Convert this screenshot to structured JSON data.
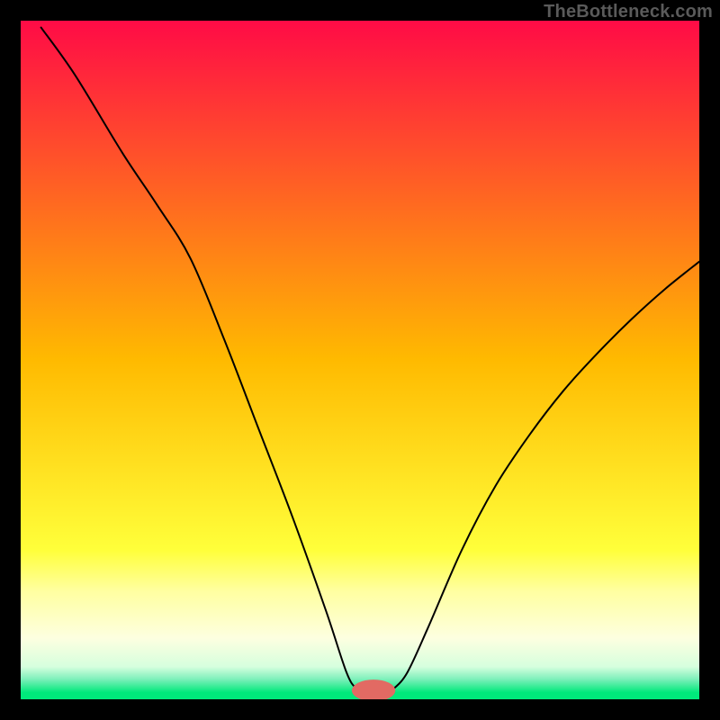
{
  "watermark": "TheBottleneck.com",
  "chart_data": {
    "type": "line",
    "title": "",
    "xlabel": "",
    "ylabel": "",
    "xlim": [
      0,
      100
    ],
    "ylim": [
      0,
      100
    ],
    "background": {
      "type": "vertical-gradient",
      "stops": [
        {
          "offset": 0.0,
          "color": "#ff0b46"
        },
        {
          "offset": 0.5,
          "color": "#ffba00"
        },
        {
          "offset": 0.78,
          "color": "#ffff3a"
        },
        {
          "offset": 0.84,
          "color": "#ffffa0"
        },
        {
          "offset": 0.91,
          "color": "#fdffe0"
        },
        {
          "offset": 0.952,
          "color": "#d6ffde"
        },
        {
          "offset": 0.97,
          "color": "#7ff0bb"
        },
        {
          "offset": 0.99,
          "color": "#00e97b"
        },
        {
          "offset": 1.0,
          "color": "#00e97b"
        }
      ]
    },
    "marker": {
      "x": 52.0,
      "y": 1.3,
      "color": "#e26a63",
      "rx": 3.2,
      "ry": 1.6
    },
    "series": [
      {
        "name": "bottleneck-curve",
        "color": "#000000",
        "width": 2,
        "points": [
          {
            "x": 3.0,
            "y": 99.0
          },
          {
            "x": 8.0,
            "y": 92.0
          },
          {
            "x": 15.0,
            "y": 80.5
          },
          {
            "x": 20.0,
            "y": 73.0
          },
          {
            "x": 25.0,
            "y": 65.0
          },
          {
            "x": 30.0,
            "y": 53.0
          },
          {
            "x": 35.0,
            "y": 40.0
          },
          {
            "x": 40.0,
            "y": 27.0
          },
          {
            "x": 45.0,
            "y": 13.0
          },
          {
            "x": 48.0,
            "y": 4.0
          },
          {
            "x": 49.5,
            "y": 1.6
          },
          {
            "x": 51.0,
            "y": 1.3
          },
          {
            "x": 54.0,
            "y": 1.3
          },
          {
            "x": 55.0,
            "y": 1.6
          },
          {
            "x": 57.0,
            "y": 4.0
          },
          {
            "x": 60.0,
            "y": 10.5
          },
          {
            "x": 65.0,
            "y": 22.0
          },
          {
            "x": 70.0,
            "y": 31.5
          },
          {
            "x": 75.0,
            "y": 39.0
          },
          {
            "x": 80.0,
            "y": 45.5
          },
          {
            "x": 85.0,
            "y": 51.0
          },
          {
            "x": 90.0,
            "y": 56.0
          },
          {
            "x": 95.0,
            "y": 60.5
          },
          {
            "x": 100.0,
            "y": 64.5
          }
        ]
      }
    ]
  }
}
